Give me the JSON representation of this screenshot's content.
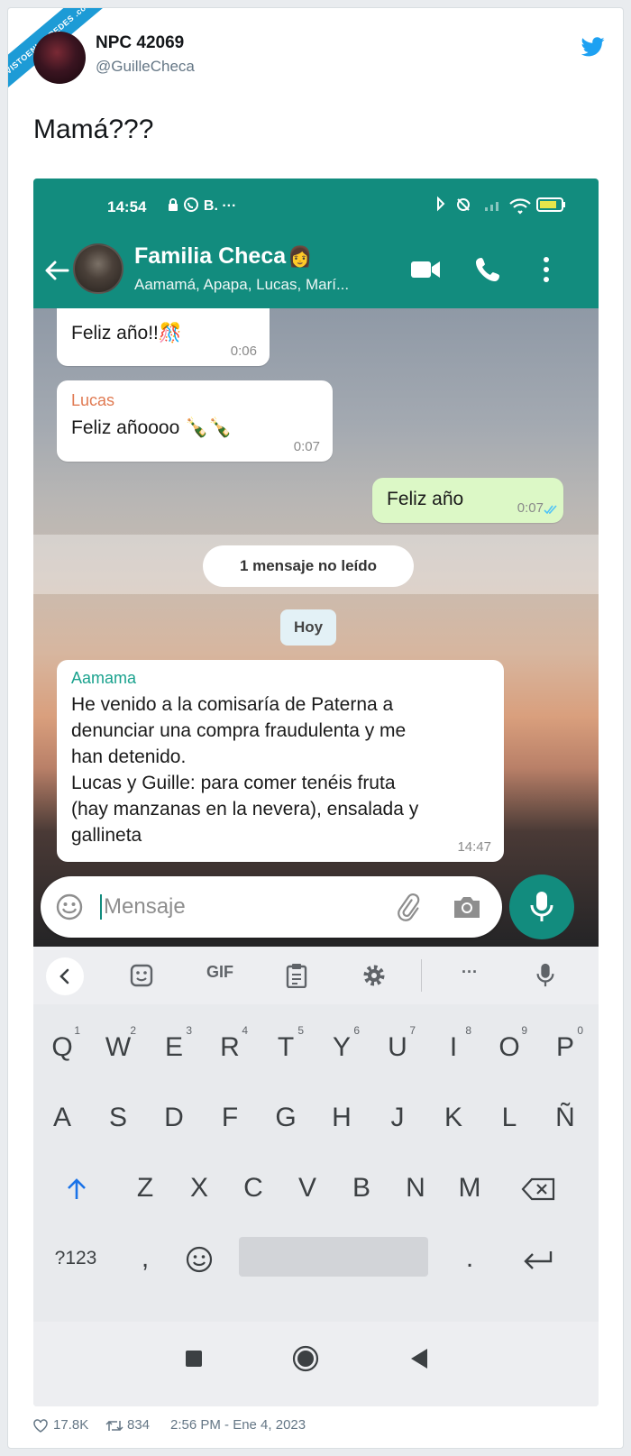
{
  "watermark": "VISTOENLASREDES .com",
  "tweet": {
    "author_name": "NPC 42069",
    "author_handle": "@GuilleCheca",
    "text": "Mamá???",
    "likes": "17.8K",
    "retweets": "834",
    "timestamp": "2:56 PM - Ene 4, 2023"
  },
  "status_bar": {
    "time": "14:54",
    "left_icons": "B. ···",
    "battery": "83"
  },
  "chat_header": {
    "group_name": "Familia Checa",
    "members": "Aamamá, Apapa, Lucas, Marí..."
  },
  "messages": [
    {
      "sender": "",
      "text": "Feliz año!!🎊",
      "time": "0:06",
      "direction": "in"
    },
    {
      "sender": "Lucas",
      "text": "Feliz añoooo 🍾🍾",
      "time": "0:07",
      "direction": "in"
    },
    {
      "sender": "",
      "text": "Feliz año",
      "time": "0:07",
      "direction": "out",
      "read": true
    },
    {
      "sender": "Aamama",
      "lines": [
        "He venido a la comisaría de Paterna a",
        "denunciar una compra fraudulenta y me",
        "han detenido.",
        "Lucas y Guille: para comer tenéis fruta",
        "(hay manzanas en la nevera), ensalada y",
        "gallineta"
      ],
      "time": "14:47",
      "direction": "in"
    }
  ],
  "unread_label": "1 mensaje no leído",
  "date_label": "Hoy",
  "composer": {
    "placeholder": "Mensaje"
  },
  "keyboard": {
    "toolbar": {
      "gif": "GIF",
      "more": "···"
    },
    "row1": [
      {
        "key": "Q",
        "num": "1"
      },
      {
        "key": "W",
        "num": "2"
      },
      {
        "key": "E",
        "num": "3"
      },
      {
        "key": "R",
        "num": "4"
      },
      {
        "key": "T",
        "num": "5"
      },
      {
        "key": "Y",
        "num": "6"
      },
      {
        "key": "U",
        "num": "7"
      },
      {
        "key": "I",
        "num": "8"
      },
      {
        "key": "O",
        "num": "9"
      },
      {
        "key": "P",
        "num": "0"
      }
    ],
    "row2": [
      "A",
      "S",
      "D",
      "F",
      "G",
      "H",
      "J",
      "K",
      "L",
      "Ñ"
    ],
    "row3": [
      "Z",
      "X",
      "C",
      "V",
      "B",
      "N",
      "M"
    ],
    "symbols_key": "?123",
    "comma_key": ",",
    "period_key": "."
  },
  "colors": {
    "whatsapp_teal": "#128c7e",
    "outgoing_bubble": "#dcf8c6",
    "twitter_blue": "#1da1f2"
  }
}
